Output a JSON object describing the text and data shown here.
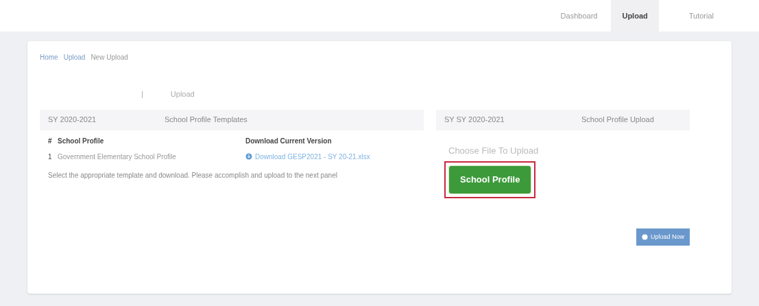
{
  "nav": [
    {
      "label": "Dashboard",
      "selected": false
    },
    {
      "label": "Upload",
      "selected": true
    },
    {
      "label": "Tutorial",
      "selected": false
    }
  ],
  "breadcrumb": [
    "Home",
    "Upload",
    "New Upload"
  ],
  "tab": {
    "separator": "|",
    "label": "Upload"
  },
  "left_panel": {
    "header": [
      "SY 2020-2021",
      "School Profile Templates"
    ],
    "columns": [
      "#",
      "School Profile",
      "Download Current Version"
    ],
    "rows": [
      {
        "number": "1",
        "name": "Government Elementary School Profile",
        "link": "Download GESP2021 - SY 20-21.xlsx"
      }
    ],
    "note": "Select the appropriate template and download. Please accomplish and upload to the next panel"
  },
  "right_panel": {
    "header": [
      "SY SY 2020-2021",
      "School Profile Upload"
    ],
    "prompt": "Choose File To Upload",
    "file_button": "School Profile",
    "highlighted": true
  },
  "upload_button": "Upload Now"
}
